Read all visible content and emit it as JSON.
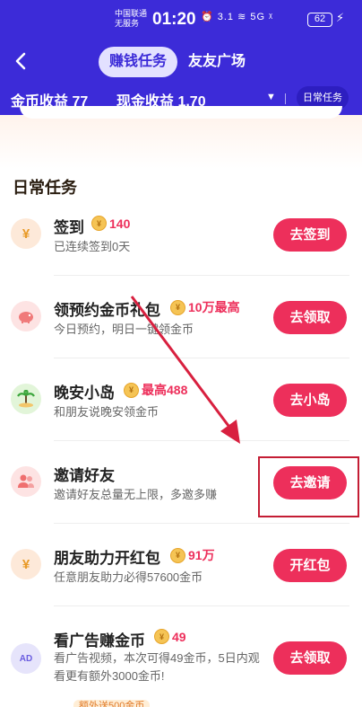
{
  "status": {
    "carrier_line1": "中国联通",
    "carrier_line2": "无服务",
    "time": "01:20",
    "icons": "⏰ 3.1 ≋ 5G ᵡ",
    "battery": "62"
  },
  "tabs": [
    {
      "label": "赚钱任务",
      "active": true
    },
    {
      "label": "友友广场",
      "active": false
    }
  ],
  "earnings": {
    "coin": "金币收益 77",
    "cash": "现金收益 1.70",
    "dropdown_label": "日常任务"
  },
  "section_title": "日常任务",
  "tasks": [
    {
      "title": "签到",
      "reward": "140",
      "desc": "已连续签到0天",
      "button": "去签到",
      "icon": "yuan-coin-icon"
    },
    {
      "title": "领预约金币礼包",
      "reward": "10万最高",
      "desc": "今日预约，明日一键领金币",
      "button": "去领取",
      "icon": "piggy-bank-icon"
    },
    {
      "title": "晚安小岛",
      "reward": "最高488",
      "desc": "和朋友说晚安领金币",
      "button": "去小岛",
      "icon": "island-icon"
    },
    {
      "title": "邀请好友",
      "reward": "",
      "desc": "邀请好友总量无上限，多邀多赚",
      "button": "去邀请",
      "icon": "friends-icon"
    },
    {
      "title": "朋友助力开红包",
      "reward": "91万",
      "desc": "任意朋友助力必得57600金币",
      "button": "开红包",
      "icon": "yuan-coin-icon"
    },
    {
      "title": "看广告赚金币",
      "reward": "49",
      "desc": "看广告视频，本次可得49金币，5日内观看更有额外3000金币!",
      "button": "去领取",
      "icon": "ad-icon"
    }
  ],
  "bottom_tag": "额外送500金币",
  "colors": {
    "header": "#3c2bd8",
    "accent": "#ed2f5b",
    "highlight": "#c41d34"
  }
}
